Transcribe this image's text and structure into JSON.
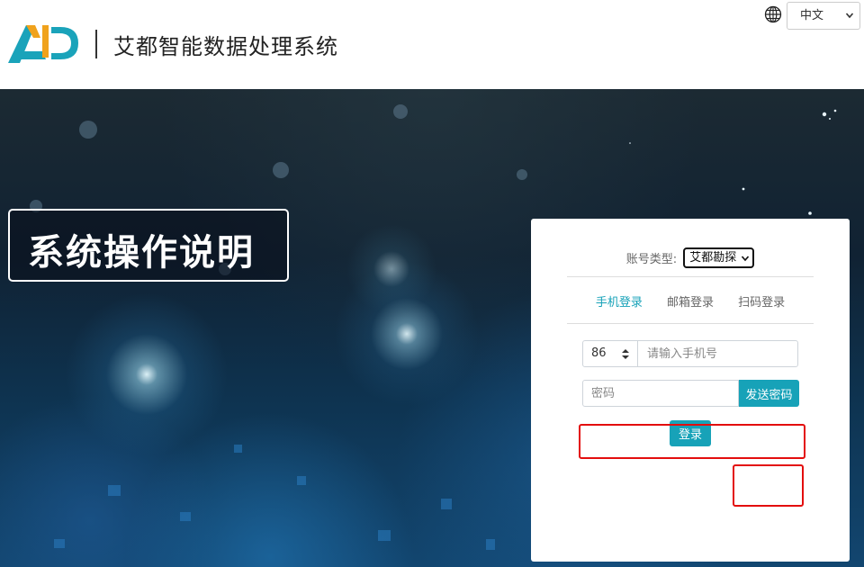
{
  "header": {
    "app_title": "艾都智能数据处理系统",
    "language": {
      "selected": "中文",
      "icon": "globe-icon"
    }
  },
  "hero": {
    "banner_text": "系统操作说明"
  },
  "login": {
    "account_type_label": "账号类型:",
    "account_type_selected": "艾都勘探",
    "tabs": [
      {
        "label": "手机登录",
        "active": true
      },
      {
        "label": "邮箱登录",
        "active": false
      },
      {
        "label": "扫码登录",
        "active": false
      }
    ],
    "country_code": "86",
    "phone_placeholder": "请输入手机号",
    "password_placeholder": "密码",
    "send_password_label": "发送密码",
    "login_label": "登录"
  },
  "colors": {
    "accent": "#17a2b8",
    "logo_teal": "#1aa3ba",
    "highlight": "#e30e0e"
  }
}
